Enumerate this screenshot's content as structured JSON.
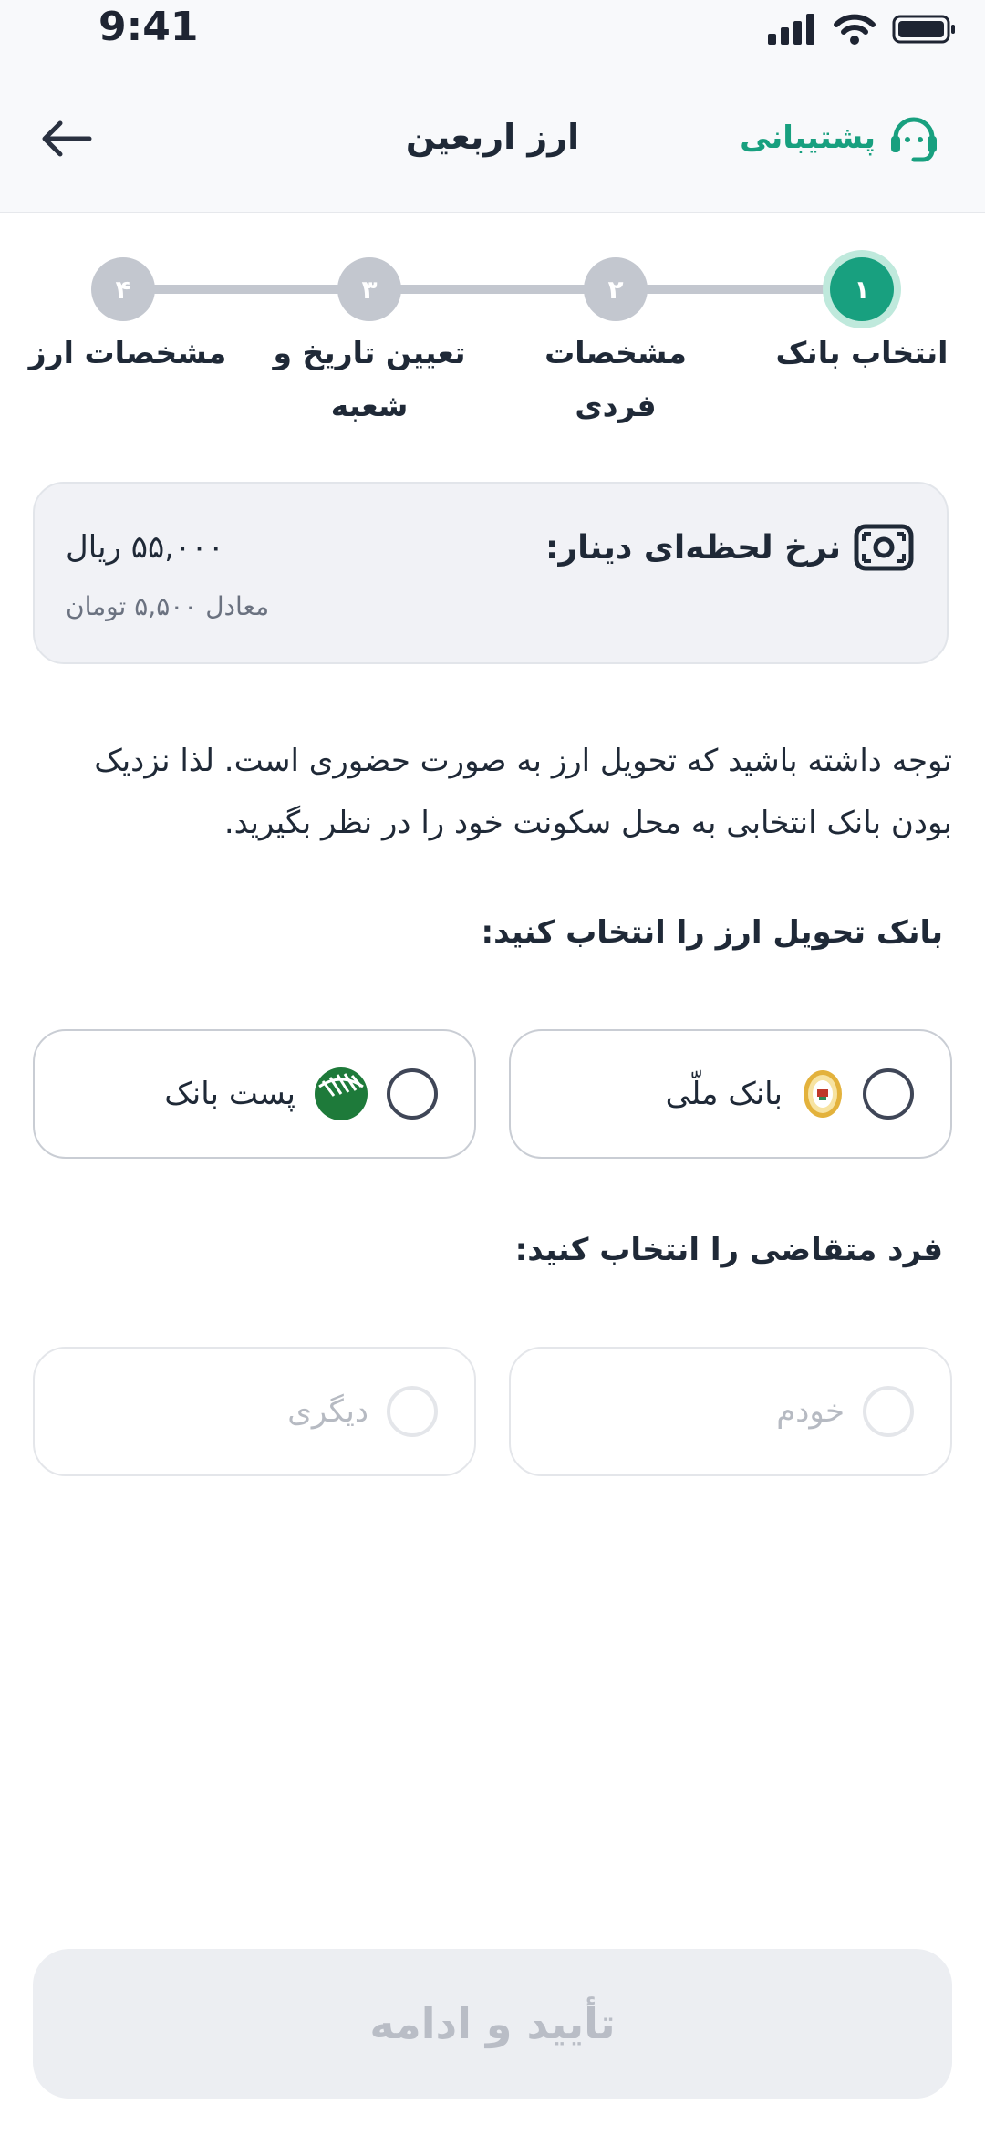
{
  "status_bar": {
    "time": "9:41"
  },
  "header": {
    "title": "ارز اربعین",
    "support_label": "پشتیبانی",
    "accent": "#18a07f"
  },
  "stepper": {
    "steps": [
      {
        "number": "۱",
        "label": "انتخاب بانک",
        "active": true
      },
      {
        "number": "۲",
        "label": "مشخصات فردی",
        "active": false
      },
      {
        "number": "۳",
        "label": "تعیین تاریخ و شعبه",
        "active": false
      },
      {
        "number": "۴",
        "label": "مشخصات ارز",
        "active": false
      }
    ]
  },
  "rate": {
    "label": "نرخ لحظه‌ای دینار:",
    "value": "۵۵,۰۰۰ ریال",
    "equivalent": "معادل ۵,۵۰۰ تومان"
  },
  "notice": "توجه داشته باشید که تحویل ارز به صورت حضوری است. لذا نزدیک بودن بانک انتخابی به محل سکونت خود را در نظر بگیرید.",
  "bank_section": {
    "label": "بانک تحویل ارز را انتخاب کنید:",
    "options": [
      {
        "label": "بانک ملّی",
        "icon": "bank-melli-logo-icon"
      },
      {
        "label": "پست بانک",
        "icon": "post-bank-logo-icon"
      }
    ]
  },
  "applicant_section": {
    "label": "فرد متقاضی را انتخاب کنید:",
    "options": [
      {
        "label": "خودم"
      },
      {
        "label": "دیگری"
      }
    ]
  },
  "confirm_button": {
    "label": "تأیید و ادامه"
  }
}
